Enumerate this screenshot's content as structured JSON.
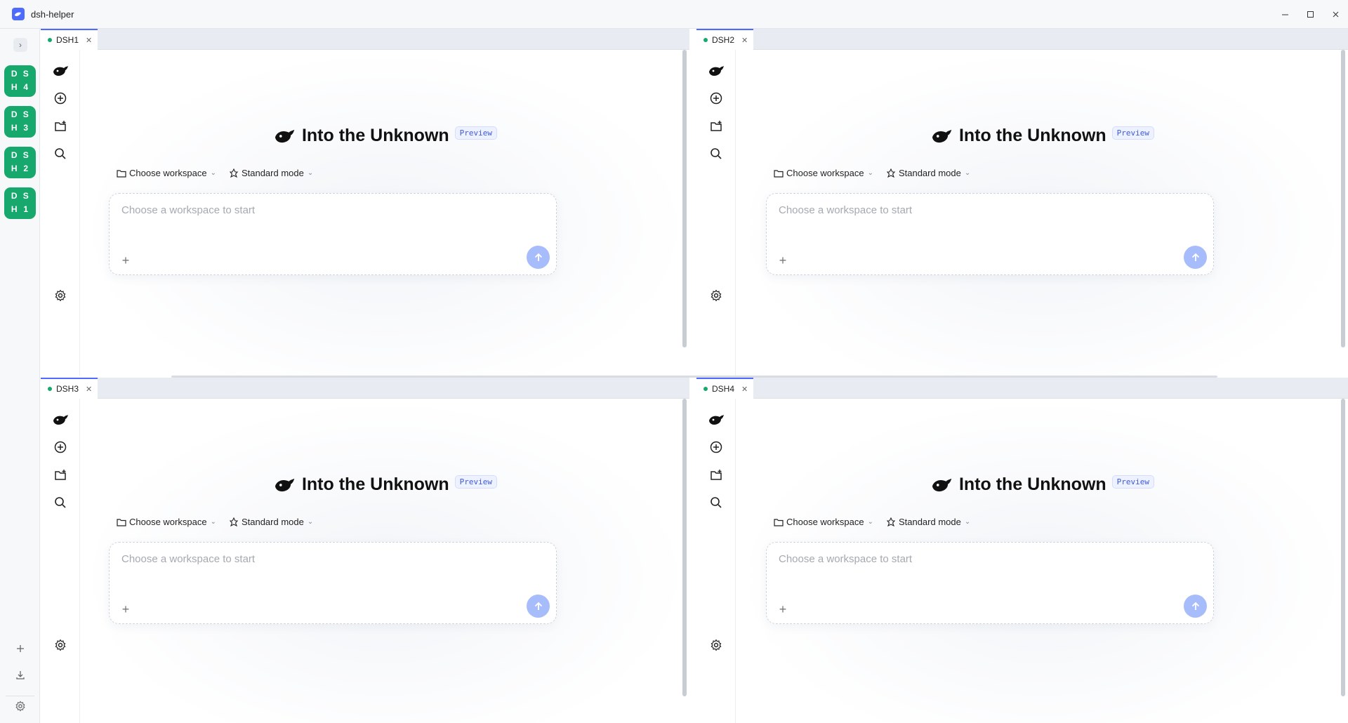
{
  "window": {
    "title": "dsh-helper",
    "controls": [
      "minimize-icon",
      "maximize-icon",
      "close-icon"
    ]
  },
  "rail": {
    "expand_icon": "chevron-right-icon",
    "sessions": [
      {
        "letters": [
          "D",
          "S",
          "H",
          "4"
        ],
        "color": "#17a86d"
      },
      {
        "letters": [
          "D",
          "S",
          "H",
          "3"
        ],
        "color": "#17a86d"
      },
      {
        "letters": [
          "D",
          "S",
          "H",
          "2"
        ],
        "color": "#17a86d"
      },
      {
        "letters": [
          "D",
          "S",
          "H",
          "1"
        ],
        "color": "#17a86d"
      }
    ],
    "bottom_icons": [
      "plus-icon",
      "download-icon",
      "gear-icon"
    ]
  },
  "panes": [
    {
      "tab": {
        "label": "DSH1",
        "status_color": "#17a86d"
      },
      "hero": {
        "title": "Into the Unknown",
        "badge": "Preview"
      },
      "workspace_label": "Choose workspace",
      "mode_label": "Standard mode",
      "input_placeholder": "Choose a workspace to start"
    },
    {
      "tab": {
        "label": "DSH2",
        "status_color": "#17a86d"
      },
      "hero": {
        "title": "Into the Unknown",
        "badge": "Preview"
      },
      "workspace_label": "Choose workspace",
      "mode_label": "Standard mode",
      "input_placeholder": "Choose a workspace to start"
    },
    {
      "tab": {
        "label": "DSH3",
        "status_color": "#17a86d"
      },
      "hero": {
        "title": "Into the Unknown",
        "badge": "Preview"
      },
      "workspace_label": "Choose workspace",
      "mode_label": "Standard mode",
      "input_placeholder": "Choose a workspace to start"
    },
    {
      "tab": {
        "label": "DSH4",
        "status_color": "#17a86d"
      },
      "hero": {
        "title": "Into the Unknown",
        "badge": "Preview"
      },
      "workspace_label": "Choose workspace",
      "mode_label": "Standard mode",
      "input_placeholder": "Choose a workspace to start"
    }
  ],
  "theme": {
    "accent": "#4d6bfe",
    "session_green": "#17a86d",
    "send_button": "#a7bdfb"
  }
}
